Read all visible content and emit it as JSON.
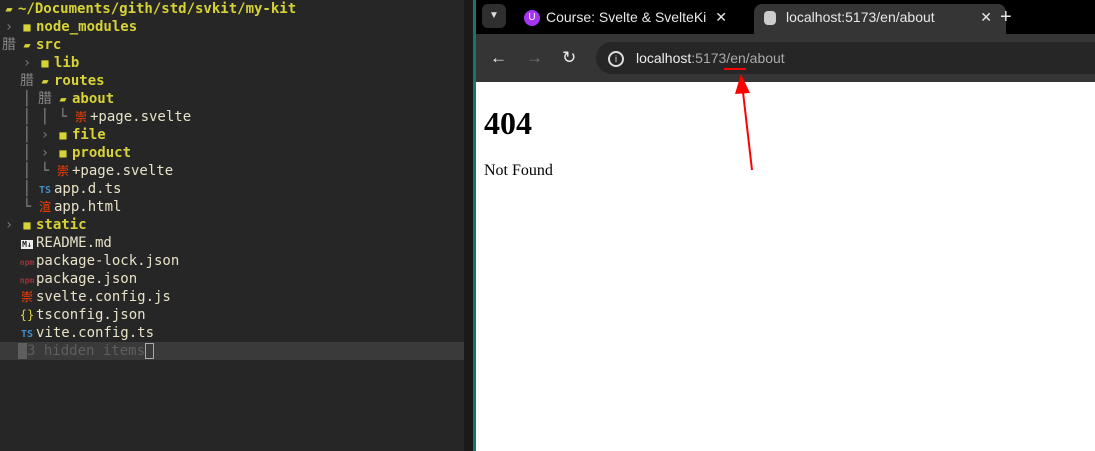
{
  "terminal": {
    "path": "~/Documents/gith/std/svkit/my-kit",
    "rows": [
      {
        "name": "node_modules",
        "type": "dir"
      },
      {
        "name": "src",
        "type": "dir-open"
      },
      {
        "name": "lib",
        "type": "dir"
      },
      {
        "name": "routes",
        "type": "dir-open"
      },
      {
        "name": "about",
        "type": "dir-open"
      },
      {
        "name": "+page.svelte",
        "type": "svelte"
      },
      {
        "name": "file",
        "type": "dir"
      },
      {
        "name": "product",
        "type": "dir"
      },
      {
        "name": "+page.svelte",
        "type": "svelte"
      },
      {
        "name": "app.d.ts",
        "type": "ts"
      },
      {
        "name": "app.html",
        "type": "html"
      },
      {
        "name": "static",
        "type": "dir"
      },
      {
        "name": "README.md",
        "type": "md"
      },
      {
        "name": "package-lock.json",
        "type": "npm"
      },
      {
        "name": "package.json",
        "type": "npm"
      },
      {
        "name": "svelte.config.js",
        "type": "svelte"
      },
      {
        "name": "tsconfig.json",
        "type": "json"
      },
      {
        "name": "vite.config.ts",
        "type": "ts"
      }
    ],
    "hidden": "3 hidden items",
    "icons": {
      "ts": "TS",
      "md": "M↓",
      "npm": "npm",
      "json": "{}",
      "open": "腊",
      "svelte": "崇",
      "html": "渲"
    }
  },
  "browser": {
    "tabs": [
      {
        "title": "Course: Svelte & SvelteKi",
        "icon": "U"
      },
      {
        "title": "localhost:5173/en/about",
        "icon": "S"
      }
    ],
    "url_host": "localhost",
    "url_rest": ":5173/en/about",
    "page": {
      "heading": "404",
      "message": "Not Found"
    }
  },
  "colors": {
    "annotation": "#ff0000",
    "accent": "#14786a"
  }
}
